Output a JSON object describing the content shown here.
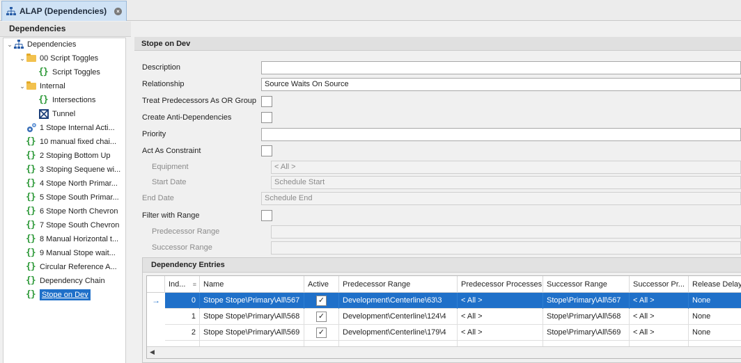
{
  "tab": {
    "title": "ALAP (Dependencies)"
  },
  "left": {
    "header": "Dependencies",
    "tree": [
      {
        "label": "Dependencies",
        "icon": "hierarchy-icon",
        "indent": 0,
        "chev": "⌄"
      },
      {
        "label": "00 Script Toggles",
        "icon": "folder-icon",
        "indent": 1,
        "chev": "⌄"
      },
      {
        "label": "Script Toggles",
        "icon": "braces-icon",
        "indent": 2,
        "chev": ""
      },
      {
        "label": "Internal",
        "icon": "folder-icon",
        "indent": 1,
        "chev": "⌄"
      },
      {
        "label": "Intersections",
        "icon": "braces-icon",
        "indent": 2,
        "chev": ""
      },
      {
        "label": "Tunnel",
        "icon": "tunnel-icon",
        "indent": 2,
        "chev": ""
      },
      {
        "label": "1 Stope Internal Acti...",
        "icon": "gears-icon",
        "indent": 1,
        "chev": ""
      },
      {
        "label": "10 manual fixed chai...",
        "icon": "braces-icon",
        "indent": 1,
        "chev": ""
      },
      {
        "label": "2 Stoping Bottom Up",
        "icon": "braces-icon",
        "indent": 1,
        "chev": ""
      },
      {
        "label": "3 Stoping Sequene wi...",
        "icon": "braces-icon",
        "indent": 1,
        "chev": ""
      },
      {
        "label": "4 Stope North Primar...",
        "icon": "braces-icon",
        "indent": 1,
        "chev": ""
      },
      {
        "label": "5 Stope South Primar...",
        "icon": "braces-icon",
        "indent": 1,
        "chev": ""
      },
      {
        "label": "6 Stope North Chevron",
        "icon": "braces-icon",
        "indent": 1,
        "chev": ""
      },
      {
        "label": "7 Stope South Chevron",
        "icon": "braces-icon",
        "indent": 1,
        "chev": ""
      },
      {
        "label": "8 Manual Horizontal t...",
        "icon": "braces-icon",
        "indent": 1,
        "chev": ""
      },
      {
        "label": "9 Manual Stope wait...",
        "icon": "braces-icon",
        "indent": 1,
        "chev": ""
      },
      {
        "label": "Circular Reference A...",
        "icon": "braces-icon",
        "indent": 1,
        "chev": ""
      },
      {
        "label": "Dependency Chain",
        "icon": "braces-icon",
        "indent": 1,
        "chev": ""
      },
      {
        "label": "Stope on Dev",
        "icon": "braces-icon",
        "indent": 1,
        "chev": "",
        "selected": true
      }
    ]
  },
  "form": {
    "header": "Stope on Dev",
    "description_label": "Description",
    "description_value": "",
    "relationship_label": "Relationship",
    "relationship_value": "Source Waits On Source",
    "treat_label": "Treat Predecessors As OR Group",
    "anti_label": "Create Anti-Dependencies",
    "priority_label": "Priority",
    "priority_value": "",
    "constraint_label": "Act As Constraint",
    "equipment_label": "Equipment",
    "equipment_value": "< All >",
    "start_label": "Start Date",
    "start_value": "Schedule Start",
    "end_label": "End Date",
    "end_value": "Schedule End",
    "filter_label": "Filter with Range",
    "pred_range_label": "Predecessor Range",
    "succ_range_label": "Successor Range"
  },
  "entries": {
    "title": "Dependency Entries",
    "columns": [
      "Ind...",
      "Name",
      "Active",
      "Predecessor Range",
      "Predecessor Processes",
      "Successor Range",
      "Successor Pr...",
      "Release Delay"
    ],
    "rows": [
      {
        "index": "0",
        "name": "Stope Stope\\Primary\\All\\567",
        "active": "✓",
        "pred_range": "Development\\Centerline\\63\\3",
        "pred_proc": "< All >",
        "succ_range": "Stope\\Primary\\All\\567",
        "succ_proc": "< All >",
        "delay": "None",
        "selected": true
      },
      {
        "index": "1",
        "name": "Stope Stope\\Primary\\All\\568",
        "active": "✓",
        "pred_range": "Development\\Centerline\\124\\4",
        "pred_proc": "< All >",
        "succ_range": "Stope\\Primary\\All\\568",
        "succ_proc": "< All >",
        "delay": "None"
      },
      {
        "index": "2",
        "name": "Stope Stope\\Primary\\All\\569",
        "active": "✓",
        "pred_range": "Development\\Centerline\\179\\4",
        "pred_proc": "< All >",
        "succ_range": "Stope\\Primary\\All\\569",
        "succ_proc": "< All >",
        "delay": "None"
      }
    ]
  }
}
